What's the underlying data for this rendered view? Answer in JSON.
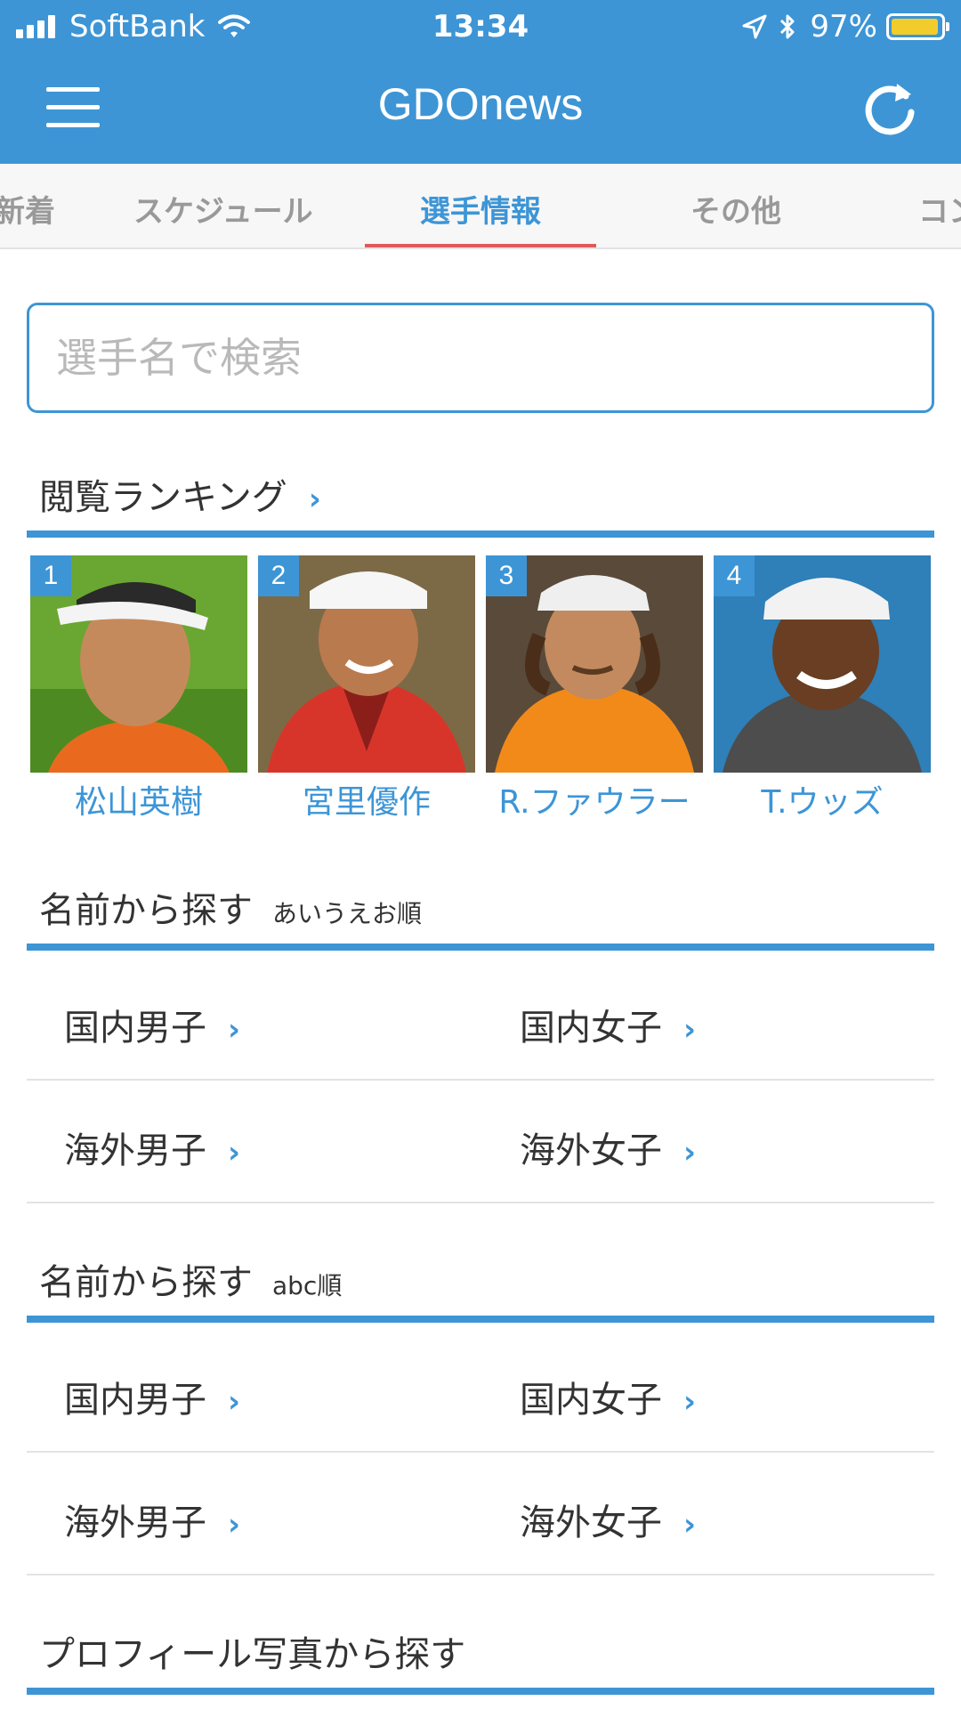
{
  "status": {
    "carrier": "SoftBank",
    "time": "13:34",
    "battery": "97%",
    "battery_level": 0.97
  },
  "nav": {
    "title": "GDOnews",
    "menu_icon": "hamburger-icon",
    "refresh_icon": "refresh-icon"
  },
  "tabs": [
    {
      "label": "新着"
    },
    {
      "label": "スケジュール"
    },
    {
      "label": "選手情報",
      "active": true
    },
    {
      "label": "その他"
    },
    {
      "label": "コン"
    }
  ],
  "search": {
    "placeholder": "選手名で検索",
    "value": ""
  },
  "ranking": {
    "title": "閲覧ランキング",
    "chevron": "›",
    "players": [
      {
        "rank": "1",
        "name": "松山英樹"
      },
      {
        "rank": "2",
        "name": "宮里優作"
      },
      {
        "rank": "3",
        "name": "R.ファウラー"
      },
      {
        "rank": "4",
        "name": "T.ウッズ"
      }
    ]
  },
  "by_kana": {
    "title": "名前から探す",
    "subtitle": "あいうえお順",
    "items": [
      "国内男子",
      "国内女子",
      "海外男子",
      "海外女子"
    ]
  },
  "by_abc": {
    "title": "名前から探す",
    "subtitle": "abc順",
    "items": [
      "国内男子",
      "国内女子",
      "海外男子",
      "海外女子"
    ]
  },
  "by_photo": {
    "title": "プロフィール写真から探す"
  },
  "colors": {
    "accent": "#3d95d6",
    "tab_indicator": "#e05a5a",
    "battery": "#f2cc2a"
  }
}
